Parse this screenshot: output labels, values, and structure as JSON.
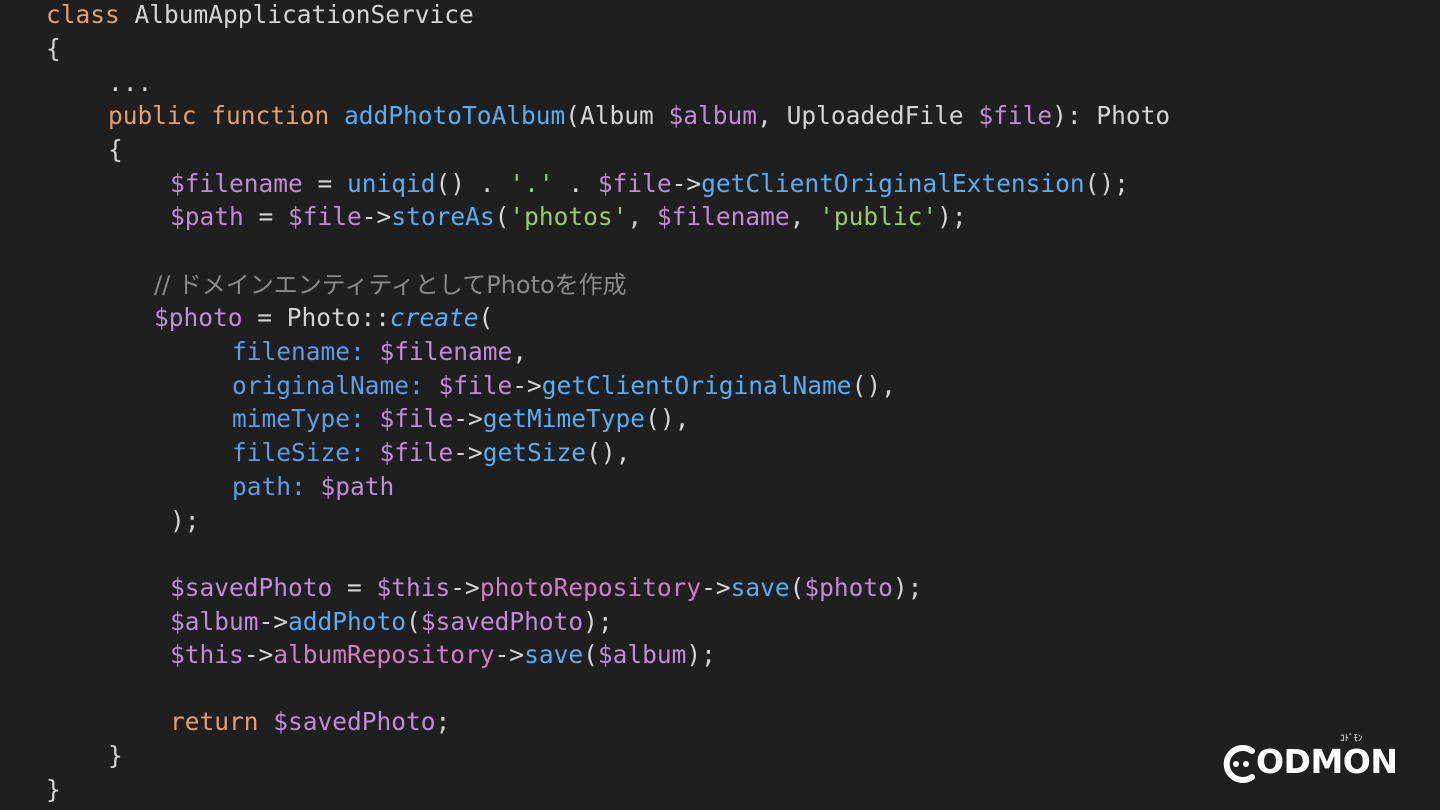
{
  "colors": {
    "background": "#1f1f1f",
    "keyword": "#e5a06a",
    "default": "#d4d4d4",
    "variable": "#c08bd8",
    "function": "#56aef4",
    "string": "#9ccc65",
    "comment": "#8a8a8a",
    "param": "#5a9ee6",
    "property": "#d37cc6"
  },
  "code_lines": [
    [
      [
        "keyword",
        "class "
      ],
      [
        "default",
        "AlbumApplicationService"
      ]
    ],
    [
      [
        "default",
        "{"
      ]
    ],
    [
      [
        "default",
        "..."
      ]
    ],
    [
      [
        "keyword",
        "public function "
      ],
      [
        "function",
        "addPhotoToAlbum"
      ],
      [
        "default",
        "(Album "
      ],
      [
        "variable",
        "$album"
      ],
      [
        "default",
        ", UploadedFile "
      ],
      [
        "variable",
        "$file"
      ],
      [
        "default",
        "): Photo"
      ]
    ],
    [
      [
        "default",
        "{"
      ]
    ],
    [
      [
        "variable",
        "$filename"
      ],
      [
        "default",
        " = "
      ],
      [
        "function",
        "uniqid"
      ],
      [
        "default",
        "() . "
      ],
      [
        "string",
        "'.'"
      ],
      [
        "default",
        " . "
      ],
      [
        "variable",
        "$file"
      ],
      [
        "default",
        "->"
      ],
      [
        "function",
        "getClientOriginalExtension"
      ],
      [
        "default",
        "();"
      ]
    ],
    [
      [
        "variable",
        "$path"
      ],
      [
        "default",
        " = "
      ],
      [
        "variable",
        "$file"
      ],
      [
        "default",
        "->"
      ],
      [
        "function",
        "storeAs"
      ],
      [
        "default",
        "("
      ],
      [
        "string",
        "'photos'"
      ],
      [
        "default",
        ", "
      ],
      [
        "variable",
        "$filename"
      ],
      [
        "default",
        ", "
      ],
      [
        "string",
        "'public'"
      ],
      [
        "default",
        ");"
      ]
    ],
    [
      [
        "comment",
        "// ドメインエンティティとしてPhotoを作成"
      ]
    ],
    [
      [
        "variable",
        "$photo"
      ],
      [
        "default",
        " = Photo::"
      ],
      [
        "function",
        "create"
      ],
      [
        "default",
        "("
      ]
    ],
    [
      [
        "param",
        "filename: "
      ],
      [
        "variable",
        "$filename"
      ],
      [
        "default",
        ","
      ]
    ],
    [
      [
        "param",
        "originalName: "
      ],
      [
        "variable",
        "$file"
      ],
      [
        "default",
        "->"
      ],
      [
        "function",
        "getClientOriginalName"
      ],
      [
        "default",
        "(),"
      ]
    ],
    [
      [
        "param",
        "mimeType: "
      ],
      [
        "variable",
        "$file"
      ],
      [
        "default",
        "->"
      ],
      [
        "function",
        "getMimeType"
      ],
      [
        "default",
        "(),"
      ]
    ],
    [
      [
        "param",
        "fileSize: "
      ],
      [
        "variable",
        "$file"
      ],
      [
        "default",
        "->"
      ],
      [
        "function",
        "getSize"
      ],
      [
        "default",
        "(),"
      ]
    ],
    [
      [
        "param",
        "path: "
      ],
      [
        "variable",
        "$path"
      ]
    ],
    [
      [
        "default",
        ");"
      ]
    ],
    [
      [
        "variable",
        "$savedPhoto"
      ],
      [
        "default",
        " = "
      ],
      [
        "variable",
        "$this"
      ],
      [
        "default",
        "->"
      ],
      [
        "property",
        "photoRepository"
      ],
      [
        "default",
        "->"
      ],
      [
        "function",
        "save"
      ],
      [
        "default",
        "("
      ],
      [
        "variable",
        "$photo"
      ],
      [
        "default",
        ");"
      ]
    ],
    [
      [
        "variable",
        "$album"
      ],
      [
        "default",
        "->"
      ],
      [
        "function",
        "addPhoto"
      ],
      [
        "default",
        "("
      ],
      [
        "variable",
        "$savedPhoto"
      ],
      [
        "default",
        ");"
      ]
    ],
    [
      [
        "variable",
        "$this"
      ],
      [
        "default",
        "->"
      ],
      [
        "property",
        "albumRepository"
      ],
      [
        "default",
        "->"
      ],
      [
        "function",
        "save"
      ],
      [
        "default",
        "("
      ],
      [
        "variable",
        "$album"
      ],
      [
        "default",
        ");"
      ]
    ],
    [
      [
        "keyword",
        "return "
      ],
      [
        "variable",
        "$savedPhoto"
      ],
      [
        "default",
        ";"
      ]
    ],
    [
      [
        "default",
        "}"
      ]
    ],
    [
      [
        "default",
        "}"
      ]
    ]
  ],
  "logo": {
    "text": "ODMON",
    "sub": "ｺﾄﾞﾓﾝ"
  }
}
